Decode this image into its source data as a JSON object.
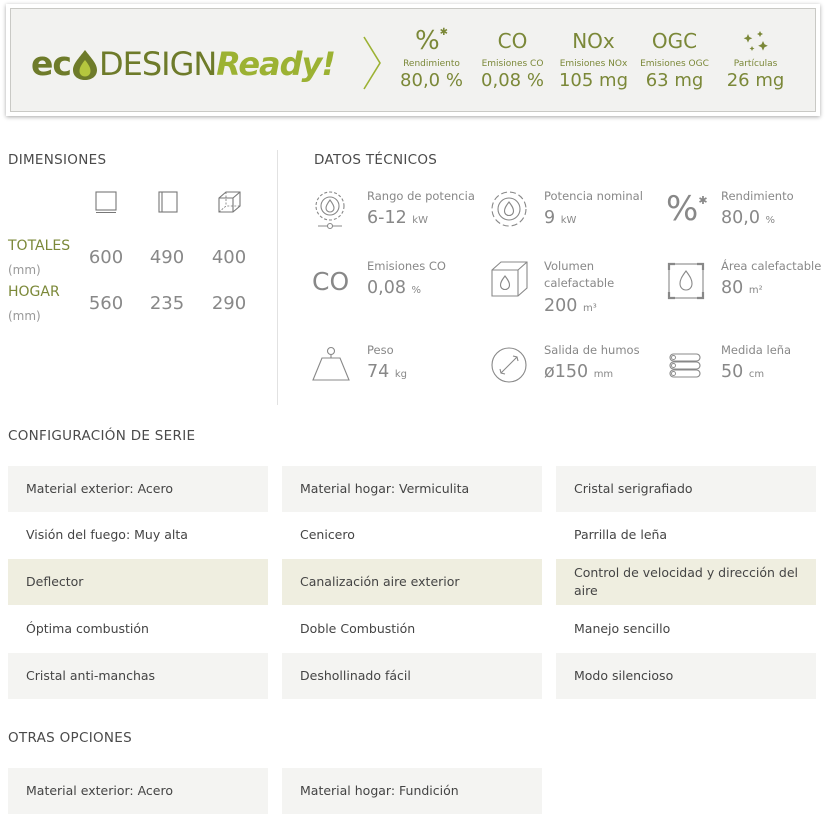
{
  "eco": {
    "logo": {
      "eco": "ec",
      "design": "DESIGN",
      "ready": "Ready!"
    },
    "metrics": [
      {
        "symbol": "%",
        "label": "Rendimiento",
        "value": "80,0 %"
      },
      {
        "symbol": "CO",
        "label": "Emisiones CO",
        "value": "0,08 %"
      },
      {
        "symbol": "NOx",
        "label": "Emisiones NOx",
        "value": "105 mg"
      },
      {
        "symbol": "OGC",
        "label": "Emisiones OGC",
        "value": "63 mg"
      },
      {
        "symbol": "",
        "label": "Partículas",
        "value": "26 mg"
      }
    ]
  },
  "dimensions": {
    "title": "DIMENSIONES",
    "icons": [
      "front-width-icon",
      "side-depth-icon",
      "cube-height-icon"
    ],
    "rows": [
      {
        "label": "TOTALES",
        "unit": "(mm)",
        "values": [
          "600",
          "490",
          "400"
        ]
      },
      {
        "label": "HOGAR",
        "unit": "(mm)",
        "values": [
          "560",
          "235",
          "290"
        ]
      }
    ]
  },
  "tech": {
    "title": "DATOS TÉCNICOS",
    "items": [
      {
        "icon": "power-range-icon",
        "label": "Rango de potencia",
        "value": "6-12",
        "unit": "kW"
      },
      {
        "icon": "nominal-power-icon",
        "label": "Potencia nominal",
        "value": "9",
        "unit": "kW"
      },
      {
        "icon": "efficiency-icon",
        "label": "Rendimiento",
        "value": "80,0",
        "unit": "%"
      },
      {
        "icon": "co-icon",
        "symbol": "CO",
        "label": "Emisiones CO",
        "value": "0,08",
        "unit": "%"
      },
      {
        "icon": "volume-icon",
        "label": "Volumen calefactable",
        "value": "200",
        "unit": "m³"
      },
      {
        "icon": "heated-area-icon",
        "label": "Área calefactable",
        "value": "80",
        "unit": "m²"
      },
      {
        "icon": "weight-icon",
        "label": "Peso",
        "value": "74",
        "unit": "kg"
      },
      {
        "icon": "flue-outlet-icon",
        "label": "Salida de humos",
        "value": "ø150",
        "unit": "mm"
      },
      {
        "icon": "log-size-icon",
        "label": "Medida leña",
        "value": "50",
        "unit": "cm"
      }
    ]
  },
  "config": {
    "title": "CONFIGURACIÓN DE SERIE",
    "items": [
      "Material exterior: Acero",
      "Material hogar: Vermiculita",
      "Cristal serigrafiado",
      "Visión del fuego: Muy alta",
      "Cenicero",
      "Parrilla de leña",
      "Deflector",
      "Canalización aire exterior",
      "Control de velocidad y dirección del aire",
      "Óptima combustión",
      "Doble Combustión",
      "Manejo sencillo",
      "Cristal anti-manchas",
      "Deshollinado fácil",
      "Modo silencioso"
    ]
  },
  "options": {
    "title": "OTRAS OPCIONES",
    "items": [
      "Material exterior: Acero",
      "Material hogar: Fundición"
    ]
  },
  "colors": {
    "accent": "#7b8838",
    "accent_light": "#9cb233",
    "text": "#444444",
    "muted": "#888888"
  }
}
